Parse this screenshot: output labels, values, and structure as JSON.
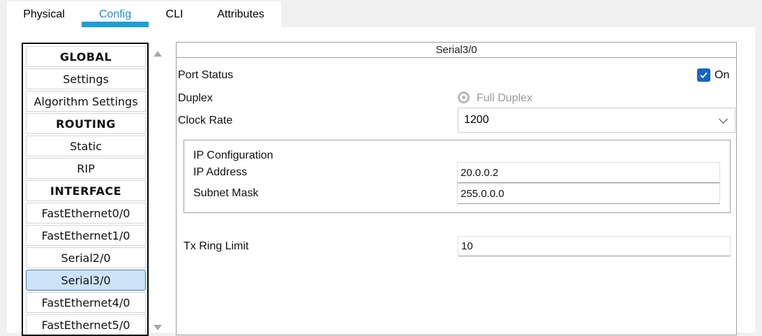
{
  "tabs": [
    {
      "label": "Physical"
    },
    {
      "label": "Config"
    },
    {
      "label": "CLI"
    },
    {
      "label": "Attributes"
    }
  ],
  "active_tab": "Config",
  "accent_color": "#1a9fd6",
  "nav": {
    "items": [
      {
        "label": "GLOBAL",
        "type": "header"
      },
      {
        "label": "Settings"
      },
      {
        "label": "Algorithm Settings"
      },
      {
        "label": "ROUTING",
        "type": "header"
      },
      {
        "label": "Static"
      },
      {
        "label": "RIP"
      },
      {
        "label": "INTERFACE",
        "type": "header"
      },
      {
        "label": "FastEthernet0/0"
      },
      {
        "label": "FastEthernet1/0"
      },
      {
        "label": "Serial2/0"
      },
      {
        "label": "Serial3/0",
        "selected": true
      },
      {
        "label": "FastEthernet4/0"
      },
      {
        "label": "FastEthernet5/0"
      }
    ]
  },
  "interface": {
    "title": "Serial3/0",
    "port_status_label": "Port Status",
    "port_status_value": "On",
    "port_status_checked": true,
    "duplex_label": "Duplex",
    "duplex_value": "Full Duplex",
    "clock_rate_label": "Clock Rate",
    "clock_rate_value": "1200",
    "ip_config": {
      "heading": "IP Configuration",
      "ip_label": "IP Address",
      "ip_value": "20.0.0.2",
      "mask_label": "Subnet Mask",
      "mask_value": "255.0.0.0"
    },
    "tx_ring_label": "Tx Ring Limit",
    "tx_ring_value": "10"
  },
  "icons": {
    "checkbox": "check-icon",
    "scroll_up": "arrow-up-icon",
    "scroll_down": "arrow-down-icon",
    "dropdown": "chevron-down-icon"
  }
}
